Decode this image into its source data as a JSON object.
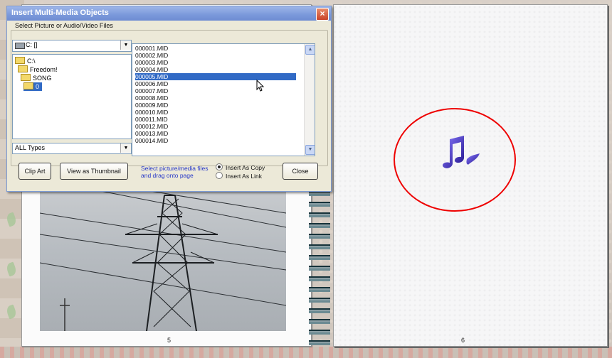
{
  "dialog": {
    "title": "Insert Multi-Media Objects",
    "close_glyph": "×",
    "group_label": "Select Picture or Audio/Video Files",
    "drive": {
      "value": "C: []",
      "icon": "drive-icon"
    },
    "directories": [
      {
        "label": "C:\\",
        "selected": false
      },
      {
        "label": "Freedom!",
        "selected": false
      },
      {
        "label": "SONG",
        "selected": false
      },
      {
        "label": "0",
        "selected": true
      }
    ],
    "file_type": "ALL Types",
    "files": [
      "000001.MID",
      "000002.MID",
      "000003.MID",
      "000004.MID",
      "000005.MID",
      "000006.MID",
      "000007.MID",
      "000008.MID",
      "000009.MID",
      "000010.MID",
      "000011.MID",
      "000012.MID",
      "000013.MID",
      "000014.MID"
    ],
    "selected_file": "000005.MID",
    "buttons": {
      "clip_art": "Clip Art",
      "view_thumbnail": "View as Thumbnail",
      "close": "Close"
    },
    "hint": "Select picture/media files and drag onto page",
    "insert_mode": {
      "options": [
        "Insert As Copy",
        "Insert As Link"
      ],
      "selected": "Insert As Copy"
    }
  },
  "album": {
    "left_page_number": "5",
    "right_page_number": "6",
    "media_icon": "music-note-icon"
  },
  "colors": {
    "selection": "#316ac5",
    "title_bar": "#7d9bdc",
    "callout": "#e00000",
    "hint_text": "#2436c8"
  }
}
